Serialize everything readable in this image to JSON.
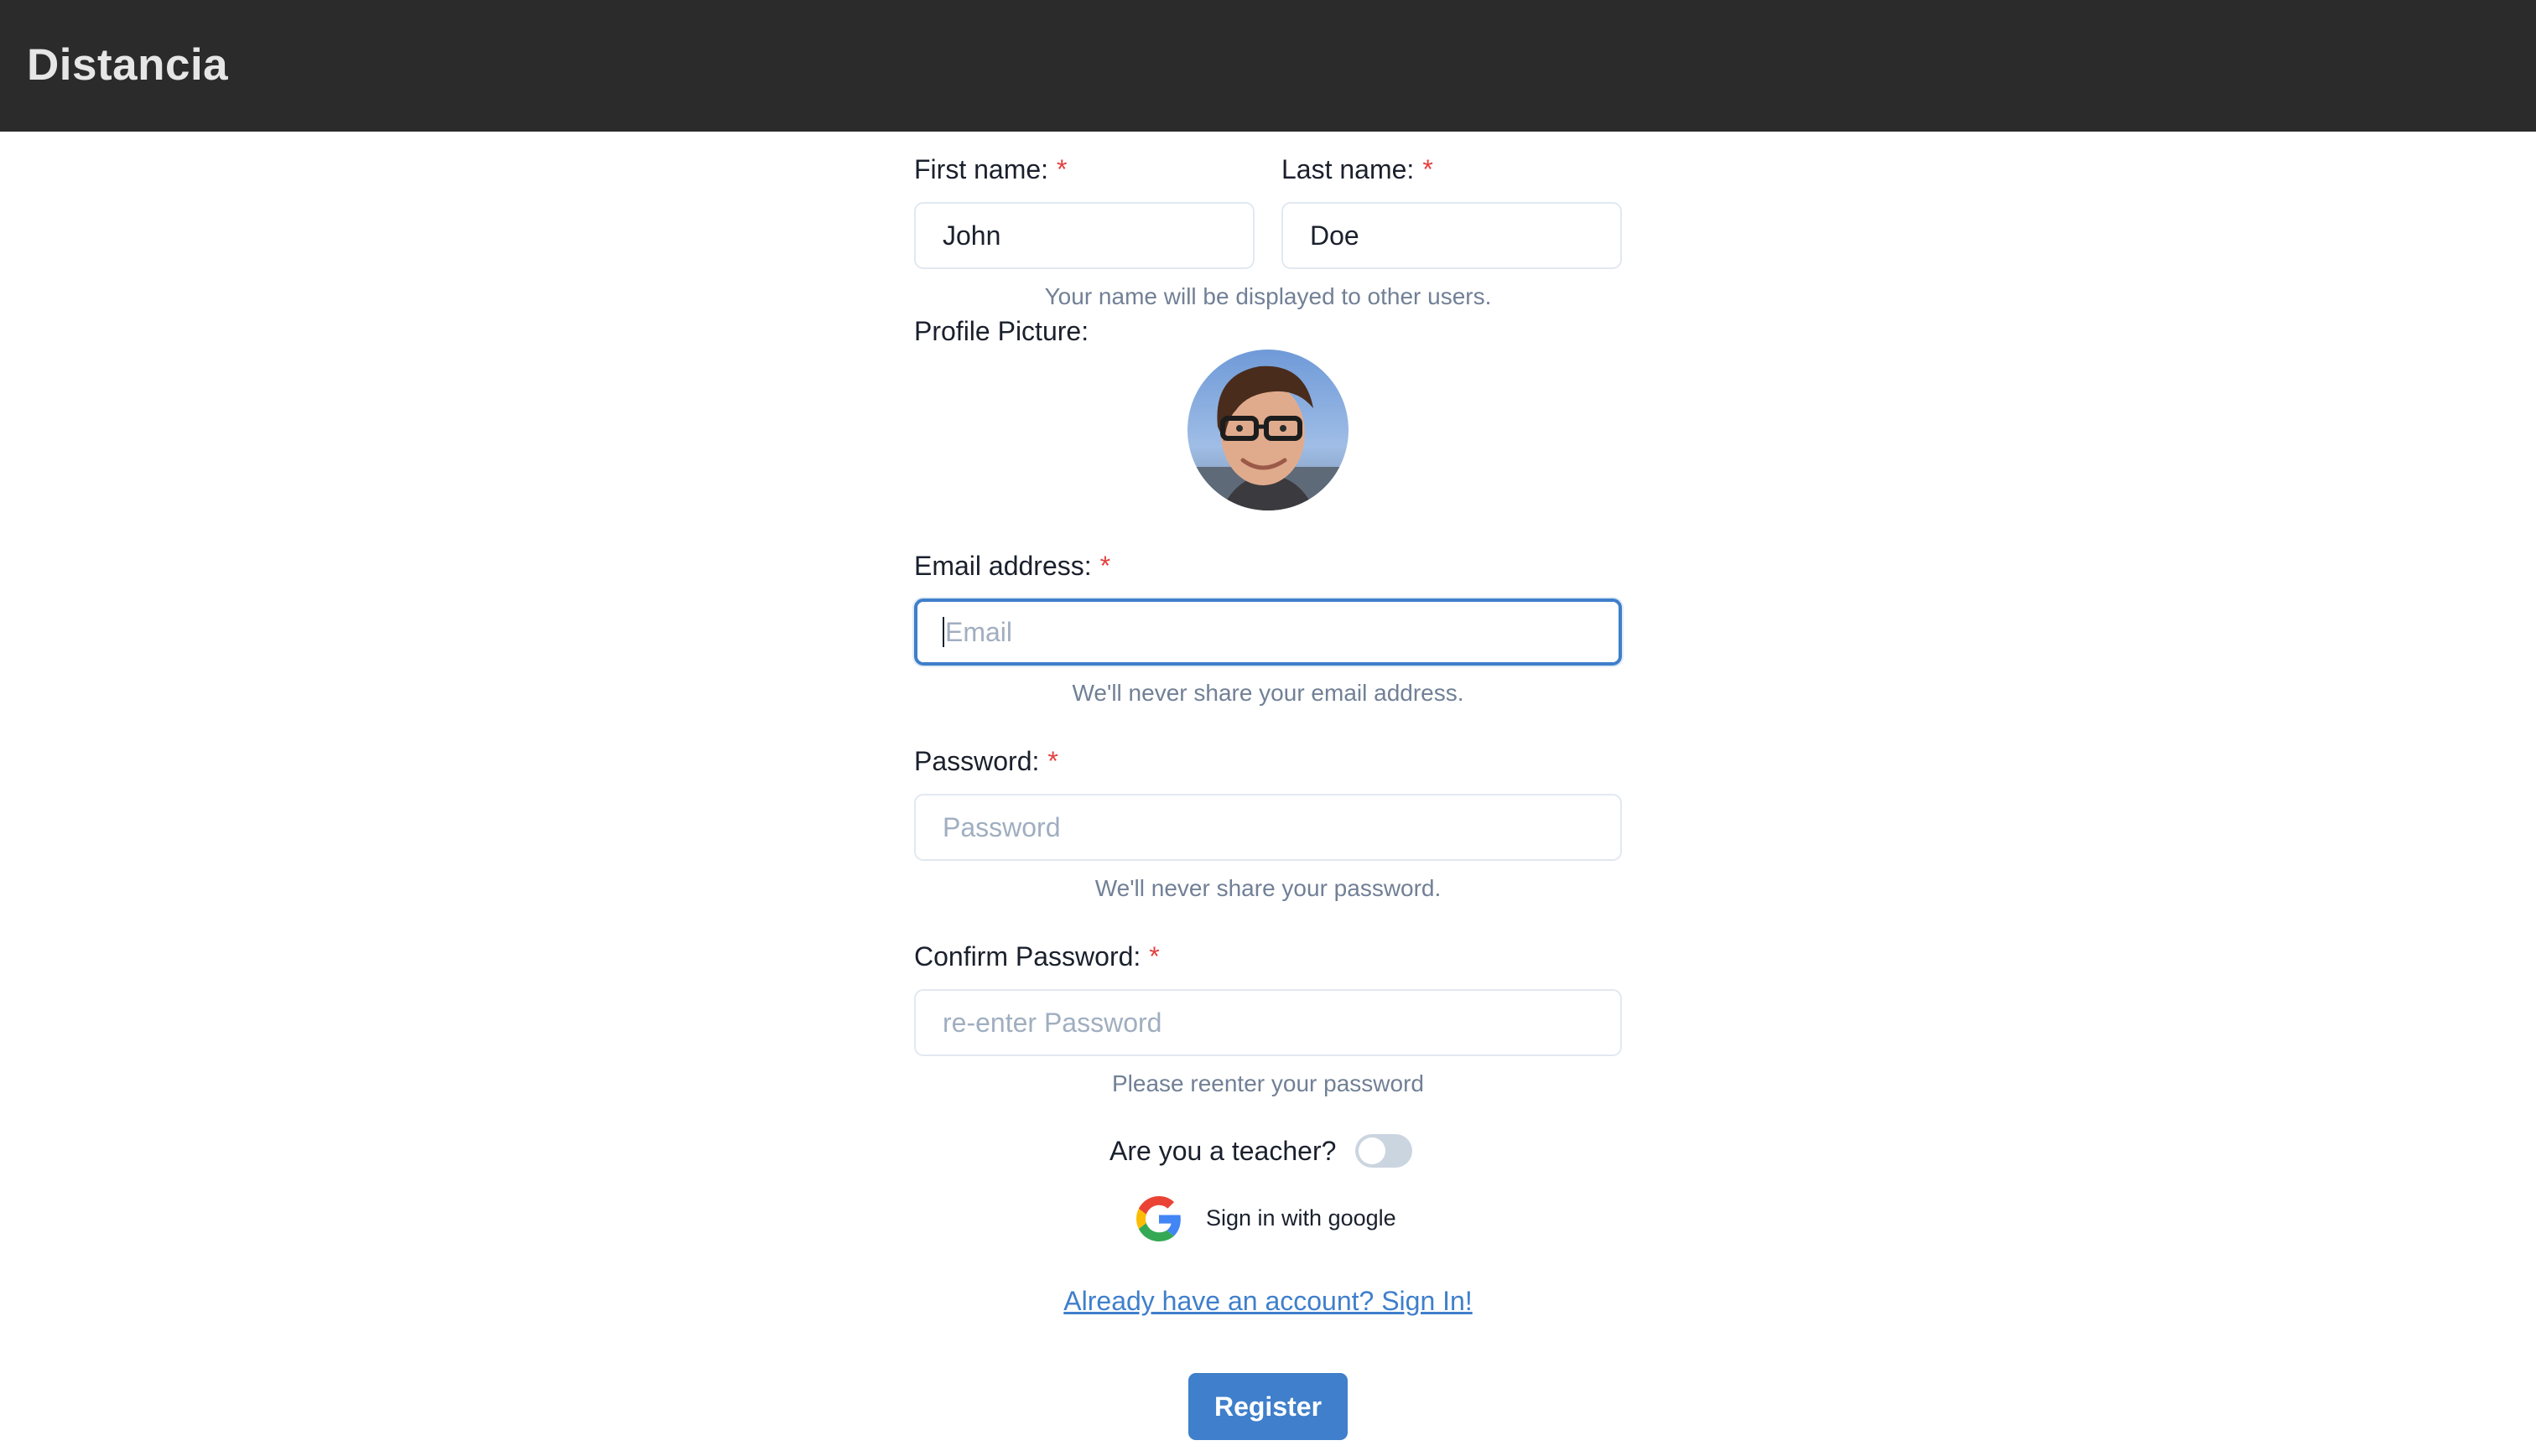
{
  "app": {
    "brand": "Distancia"
  },
  "form": {
    "first_name": {
      "label": "First name:",
      "required": "*",
      "value": "John"
    },
    "last_name": {
      "label": "Last name:",
      "required": "*",
      "value": "Doe"
    },
    "name_help": "Your name will be displayed to other users.",
    "profile_picture": {
      "label": "Profile Picture:"
    },
    "email": {
      "label": "Email address:",
      "required": "*",
      "placeholder": "Email",
      "help": "We'll never share your email address."
    },
    "password": {
      "label": "Password:",
      "required": "*",
      "placeholder": "Password",
      "help": "We'll never share your password."
    },
    "confirm_password": {
      "label": "Confirm Password:",
      "required": "*",
      "placeholder": "re-enter Password",
      "help": "Please reenter your password"
    },
    "teacher": {
      "label": "Are you a teacher?",
      "checked": false
    },
    "google": {
      "label": "Sign in with google",
      "icon": "google-icon"
    },
    "signin_link": "Already have an account? Sign In!",
    "register_label": "Register"
  },
  "colors": {
    "navbar": "#2b2b2b",
    "accent": "#3f7fcb",
    "required": "#e53e3e",
    "helper_text": "#718096"
  }
}
